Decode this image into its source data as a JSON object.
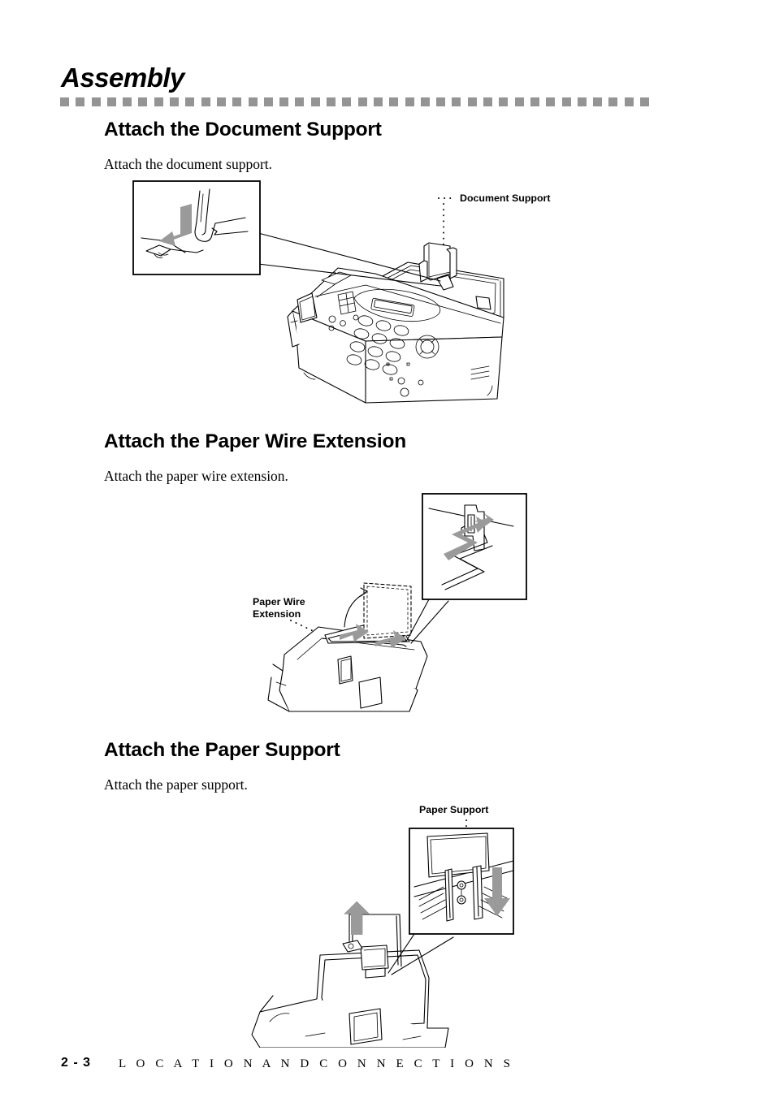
{
  "document": {
    "title": "Assembly",
    "footer": {
      "page_number": "2 - 3",
      "chapter": "L O C A T I O N   A N D   C O N N E C T I O N S"
    }
  },
  "sections": [
    {
      "heading": "Attach the Document Support",
      "body": "Attach the document support.",
      "figure": {
        "name": "document-support-figure",
        "callout_labels": [
          "Document Support"
        ]
      }
    },
    {
      "heading": "Attach the Paper Wire Extension",
      "body": "Attach the paper wire extension.",
      "figure": {
        "name": "paper-wire-extension-figure",
        "callout_labels": [
          "Paper Wire\nExtension"
        ]
      }
    },
    {
      "heading": "Attach the Paper Support",
      "body": "Attach the paper support.",
      "figure": {
        "name": "paper-support-figure",
        "callout_labels": [
          "Paper Support"
        ]
      }
    }
  ],
  "style": {
    "rule_color": "#949494",
    "arrow_color": "#9a9a9a",
    "ink_color": "#000000",
    "paper_color": "#ffffff"
  }
}
